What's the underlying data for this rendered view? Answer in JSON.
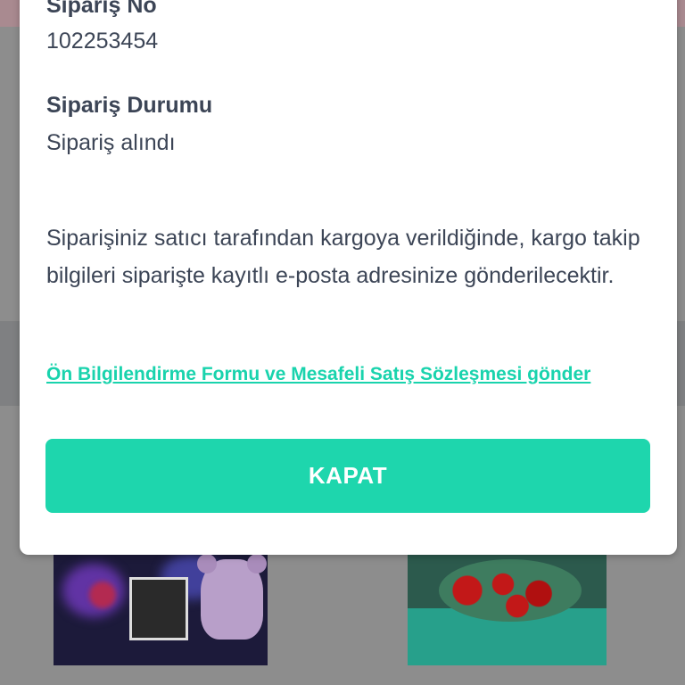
{
  "modal": {
    "order_no_label": "Sipariş No",
    "order_no_value": "102253454",
    "order_status_label": "Sipariş Durumu",
    "order_status_value": "Sipariş alındı",
    "info_text": "Siparişiniz satıcı tarafından kargoya verildiğinde, kargo takip bilgileri siparişte kayıtlı e-posta adresinize gönderilecektir.",
    "link_text": "Ön Bilgilendirme Formu ve Mesafeli Satış Sözleşmesi gönder",
    "close_button_label": "KAPAT"
  },
  "colors": {
    "accent": "#1ed6ad",
    "link": "#19d3ad",
    "text": "#3c4556",
    "overlay": "#8d8d8d"
  }
}
